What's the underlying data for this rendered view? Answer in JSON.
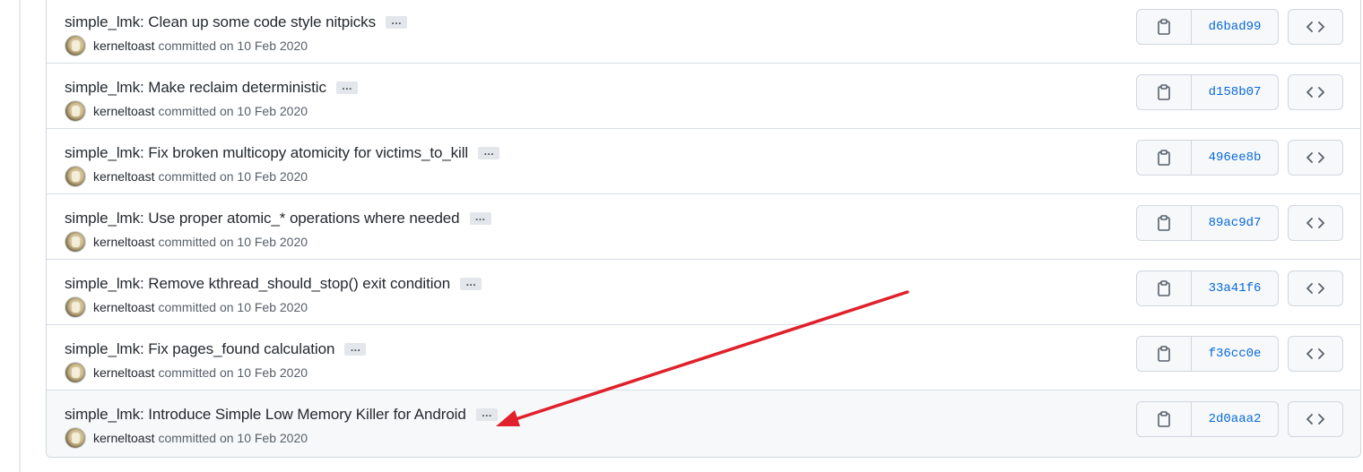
{
  "commits": [
    {
      "message": "simple_lmk: Clean up some code style nitpicks",
      "ellipsis": "…",
      "author": "kerneltoast",
      "meta": "committed on 10 Feb 2020",
      "sha": "d6bad99"
    },
    {
      "message": "simple_lmk: Make reclaim deterministic",
      "ellipsis": "…",
      "author": "kerneltoast",
      "meta": "committed on 10 Feb 2020",
      "sha": "d158b07"
    },
    {
      "message": "simple_lmk: Fix broken multicopy atomicity for victims_to_kill",
      "ellipsis": "…",
      "author": "kerneltoast",
      "meta": "committed on 10 Feb 2020",
      "sha": "496ee8b"
    },
    {
      "message": "simple_lmk: Use proper atomic_* operations where needed",
      "ellipsis": "…",
      "author": "kerneltoast",
      "meta": "committed on 10 Feb 2020",
      "sha": "89ac9d7"
    },
    {
      "message": "simple_lmk: Remove kthread_should_stop() exit condition",
      "ellipsis": "…",
      "author": "kerneltoast",
      "meta": "committed on 10 Feb 2020",
      "sha": "33a41f6"
    },
    {
      "message": "simple_lmk: Fix pages_found calculation",
      "ellipsis": "…",
      "author": "kerneltoast",
      "meta": "committed on 10 Feb 2020",
      "sha": "f36cc0e"
    },
    {
      "message": "simple_lmk: Introduce Simple Low Memory Killer for Android",
      "ellipsis": "…",
      "author": "kerneltoast",
      "meta": "committed on 10 Feb 2020",
      "sha": "2d0aaa2"
    }
  ],
  "icons": {
    "copy": "clipboard-icon",
    "browse": "code-brackets-icon",
    "avatar": "kerneltoast-avatar"
  },
  "colors": {
    "annotation_arrow": "#e0202a",
    "sha_link": "#0969da",
    "hover_row": "#f6f8fa"
  }
}
